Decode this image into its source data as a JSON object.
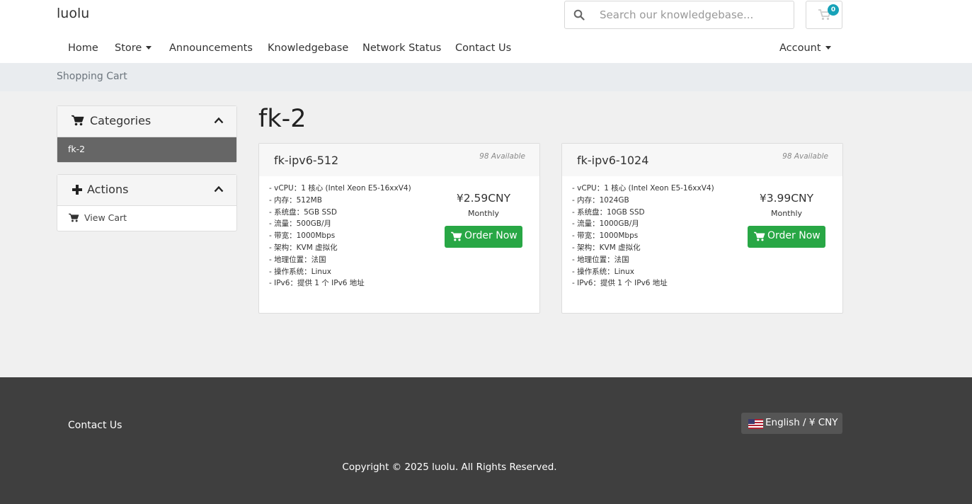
{
  "header": {
    "brand": "luolu",
    "search_placeholder": "Search our knowledgebase...",
    "cart_count": "0"
  },
  "nav": {
    "home": "Home",
    "store": "Store",
    "announcements": "Announcements",
    "knowledgebase": "Knowledgebase",
    "network_status": "Network Status",
    "contact_us": "Contact Us",
    "account": "Account"
  },
  "breadcrumb": "Shopping Cart",
  "sidebar": {
    "categories_title": "Categories",
    "categories": [
      "fk-2"
    ],
    "actions_title": "Actions",
    "view_cart": "View Cart"
  },
  "main": {
    "heading": "fk-2",
    "products": [
      {
        "name": "fk-ipv6-512",
        "available": "98 Available",
        "features": [
          "- vCPU：1 核心 (Intel Xeon E5-16xxV4)",
          "- 内存：512MB",
          "- 系统盘：5GB SSD",
          "- 流量：500GB/月",
          "- 带宽：1000Mbps",
          "- 架构：KVM 虚拟化",
          "- 地理位置：法国",
          "- 操作系统：Linux",
          "- IPv6：提供 1 个 IPv6 地址"
        ],
        "price": "¥2.59CNY",
        "cycle": "Monthly",
        "order_label": "Order Now"
      },
      {
        "name": "fk-ipv6-1024",
        "available": "98 Available",
        "features": [
          "- vCPU：1 核心 (Intel Xeon E5-16xxV4)",
          "- 内存：1024GB",
          "- 系统盘：10GB SSD",
          "- 流量：1000GB/月",
          "- 带宽：1000Mbps",
          "- 架构：KVM 虚拟化",
          "- 地理位置：法国",
          "- 操作系统：Linux",
          "- IPv6：提供 1 个 IPv6 地址"
        ],
        "price": "¥3.99CNY",
        "cycle": "Monthly",
        "order_label": "Order Now"
      }
    ]
  },
  "footer": {
    "contact": "Contact Us",
    "language": "English / ¥ CNY",
    "copyright": "Copyright © 2025 luolu. All Rights Reserved."
  },
  "colors": {
    "order_button": "#28a745",
    "badge": "#17a2b8",
    "footer_bg": "#3f3f3f",
    "active_category": "#666666"
  }
}
